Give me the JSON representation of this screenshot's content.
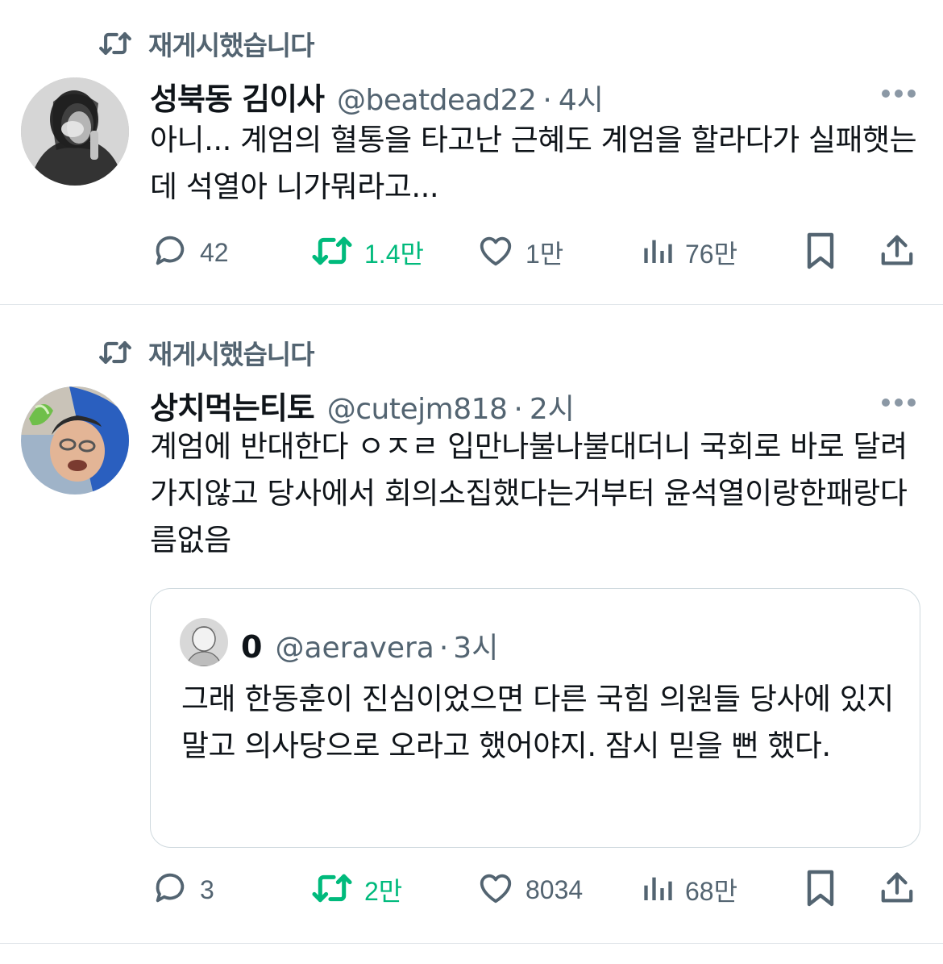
{
  "tweets": [
    {
      "repost_label": "재게시했습니다",
      "name": "성북동 김이사",
      "handle": "@beatdead22",
      "separator": "·",
      "time": "4시",
      "text": "아니... 계엄의 혈통을 타고난 근혜도 계엄을 할라다가 실패햇는데 석열아 니가뭐라고...",
      "replies": "42",
      "reposts": "1.4만",
      "likes": "1만",
      "views": "76만"
    },
    {
      "repost_label": "재게시했습니다",
      "name": "상치먹는티토",
      "handle": "@cutejm818",
      "separator": "·",
      "time": "2시",
      "text": "계엄에 반대한다 ㅇㅈㄹ 입만나불나불대더니 국회로 바로 달려가지않고 당사에서 회의소집했다는거부터 윤석열이랑한패랑다름없음",
      "replies": "3",
      "reposts": "2만",
      "likes": "8034",
      "views": "68만",
      "quote": {
        "name": "0",
        "handle": "@aeravera",
        "separator": "·",
        "time": "3시",
        "text": "그래 한동훈이 진심이었으면 다른 국힘 의원들 당사에 있지 말고 의사당으로 오라고 했어야지. 잠시 믿을 뻔 했다."
      }
    }
  ],
  "icons": {
    "repost": "repost-icon",
    "reply": "reply-icon",
    "like": "heart-icon",
    "views": "views-icon",
    "bookmark": "bookmark-icon",
    "share": "share-icon",
    "more": "more-icon"
  },
  "colors": {
    "text": "#0f1419",
    "secondary": "#536471",
    "repost_green": "#00ba7c",
    "divider": "#e1e6ea"
  }
}
